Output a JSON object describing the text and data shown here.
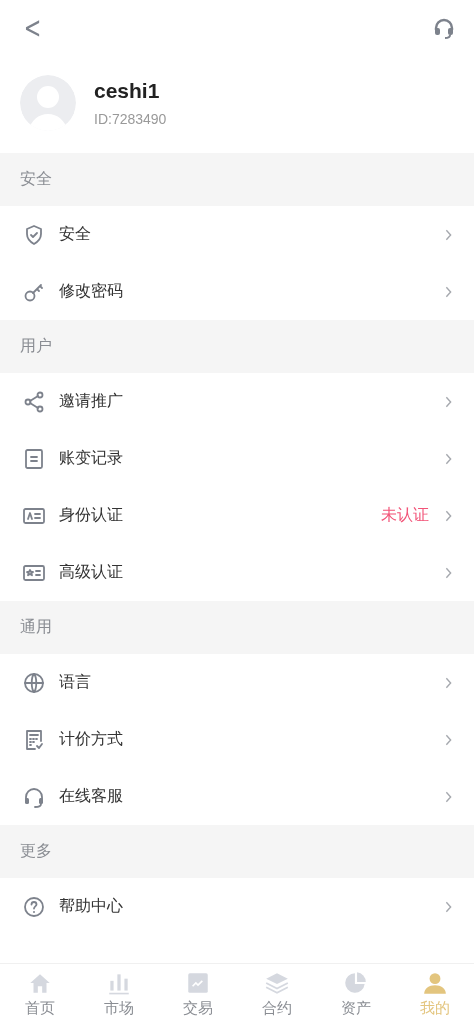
{
  "header": {
    "back": "<"
  },
  "profile": {
    "name": "ceshi1",
    "id": "ID:7283490"
  },
  "sections": [
    {
      "title": "安全",
      "items": [
        {
          "label": "安全"
        },
        {
          "label": "修改密码"
        }
      ]
    },
    {
      "title": "用户",
      "items": [
        {
          "label": "邀请推广"
        },
        {
          "label": "账变记录"
        },
        {
          "label": "身份认证",
          "status": "未认证"
        },
        {
          "label": "高级认证"
        }
      ]
    },
    {
      "title": "通用",
      "items": [
        {
          "label": "语言"
        },
        {
          "label": "计价方式"
        },
        {
          "label": "在线客服"
        }
      ]
    },
    {
      "title": "更多",
      "items": [
        {
          "label": "帮助中心"
        }
      ]
    }
  ],
  "tabs": [
    {
      "label": "首页",
      "selected": false
    },
    {
      "label": "市场",
      "selected": false
    },
    {
      "label": "交易",
      "selected": false
    },
    {
      "label": "合约",
      "selected": false
    },
    {
      "label": "资产",
      "selected": false
    },
    {
      "label": "我的",
      "selected": true
    }
  ]
}
